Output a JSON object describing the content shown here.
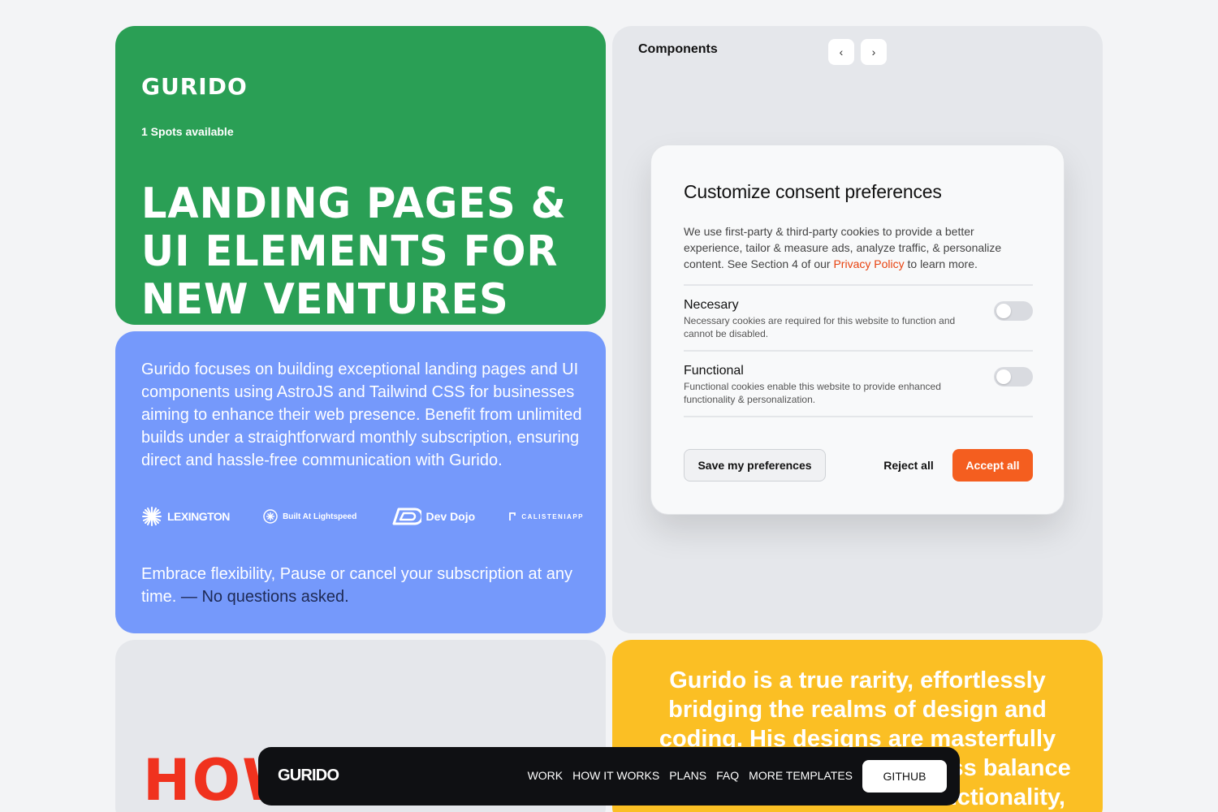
{
  "hero": {
    "logo": "GURIDO",
    "spots": "1 Spots available",
    "headline": "LANDING PAGES & UI ELEMENTS FOR NEW VENTURES"
  },
  "about": {
    "body": "Gurido focuses on building exceptional landing pages and UI components using AstroJS and Tailwind CSS for businesses aiming to enhance their web presence. Benefit from unlimited builds under a straightforward monthly subscription, ensuring direct and hassle-free communication with Gurido.",
    "logos": [
      "LEXINGTON",
      "Built At Lightspeed",
      "Dev Dojo",
      "CALISTENIAPP"
    ],
    "flex_text": "Embrace flexibility, Pause or cancel your subscription at any time.",
    "flex_tail": "— No questions asked."
  },
  "components": {
    "title": "Components",
    "consent": {
      "heading": "Customize consent preferences",
      "intro_before": "We use first-party & third-party cookies to provide a better experience, tailor & measure ads, analyze traffic, & personalize content. See Section 4 of our ",
      "intro_link": "Privacy Policy",
      "intro_after": " to learn more.",
      "prefs": [
        {
          "title": "Necesary",
          "desc": "Necessary cookies are required for this website to function and cannot be disabled.",
          "enabled": false
        },
        {
          "title": "Functional",
          "desc": "Functional cookies enable this website to provide enhanced functionality & personalization.",
          "enabled": false
        }
      ],
      "save_label": "Save my preferences",
      "reject_label": "Reject all",
      "accept_label": "Accept all"
    }
  },
  "how": {
    "text": "HOW"
  },
  "quote": {
    "text": "Gurido is a true rarity, effortlessly bridging the realms of design and coding. His designs are masterfully crafted, achieving a seamless balance between aesthetics and functionality, while remaining"
  },
  "navbar": {
    "brand": "GURIDO",
    "links": [
      "WORK",
      "HOW IT WORKS",
      "PLANS",
      "FAQ",
      "MORE TEMPLATES"
    ],
    "github": "GITHUB"
  },
  "colors": {
    "hero_bg": "#2a9f55",
    "about_bg": "#7599fb",
    "quote_bg": "#fbbf24",
    "accent": "#f45e1f",
    "how_red": "#f0321e"
  }
}
